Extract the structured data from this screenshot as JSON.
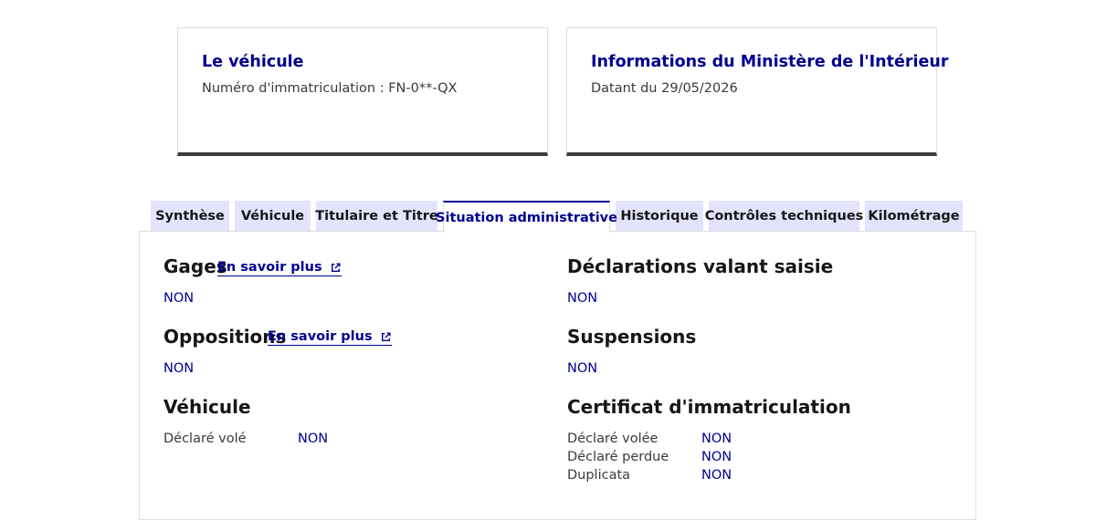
{
  "cards": {
    "vehicle": {
      "title": "Le véhicule",
      "subtitle": "Numéro d'immatriculation : FN-0**-QX"
    },
    "ministry": {
      "title": "Informations du Ministère de l'Intérieur",
      "subtitle": "Datant du 29/05/2026"
    }
  },
  "tabs": [
    {
      "label": "Synthèse"
    },
    {
      "label": "Véhicule"
    },
    {
      "label": "Titulaire et Titre"
    },
    {
      "label": "Situation administrative",
      "active": true
    },
    {
      "label": "Historique"
    },
    {
      "label": "Contrôles techniques"
    },
    {
      "label": "Kilométrage"
    }
  ],
  "panel": {
    "gages": {
      "title": "Gages",
      "link": "En savoir plus",
      "value": "NON"
    },
    "declarations": {
      "title": "Déclarations valant saisie",
      "value": "NON"
    },
    "oppositions": {
      "title": "Oppositions",
      "link": "En savoir plus",
      "value": "NON"
    },
    "suspensions": {
      "title": "Suspensions",
      "value": "NON"
    },
    "vehicule": {
      "title": "Véhicule",
      "rows": [
        {
          "label": "Déclaré volé",
          "value": "NON"
        }
      ]
    },
    "certificat": {
      "title": "Certificat d'immatriculation",
      "rows": [
        {
          "label": "Déclaré volée",
          "value": "NON"
        },
        {
          "label": "Déclaré perdue",
          "value": "NON"
        },
        {
          "label": "Duplicata",
          "value": "NON"
        }
      ]
    }
  },
  "colors": {
    "accent": "#000091",
    "tab_bg": "#e3e3fd",
    "border": "#dddddd",
    "card_bottom": "#3a3a3a"
  },
  "icons": {
    "external_link": "external-link-icon"
  }
}
